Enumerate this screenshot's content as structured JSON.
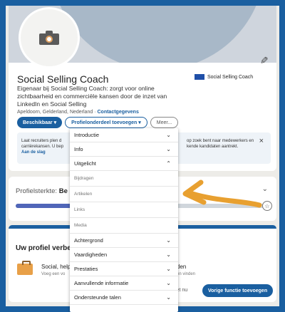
{
  "profile": {
    "name": "Social Selling Coach",
    "company": "Social Selling Coach",
    "headline": "Eigenaar bij Social Selling Coach: zorgt voor online zichtbaarheid en commerciële kansen door de inzet van LinkedIn en Social Selling",
    "location": "Apeldoorn, Gelderland, Nederland",
    "location_sep": " · ",
    "contact_link": "Contactgegevens",
    "buttons": {
      "available": "Beschikbaar ▾",
      "add_section": "Profielonderdeel toevoegen ▾",
      "more": "Meer..."
    }
  },
  "notice": {
    "left_text": "Laat recruiters plen d carrièrekansen. U bep",
    "left_link": "Aan de slag",
    "right_text": "op zoek bent naar medewerkers en kende kandidaten aantrekt.",
    "close": "×"
  },
  "strength": {
    "label": "Profielsterkte: ",
    "value": "Be",
    "progress": 0.62,
    "star": "☆"
  },
  "suggest": {
    "title": "Uw profiel verbe",
    "item": "Social, help",
    "item_sub": "Voeg een vo",
    "right_title": "den",
    "right_sub": "en vinden",
    "not_now": "iet nu",
    "button": "Vorige functie toevoegen"
  },
  "dropdown": {
    "rows": [
      {
        "type": "row",
        "label": "Introductie",
        "chev": "⌄"
      },
      {
        "type": "row",
        "label": "Info",
        "chev": "⌄"
      },
      {
        "type": "row",
        "label": "Uitgelicht",
        "chev": "⌃"
      },
      {
        "type": "sub",
        "label": "Bijdragen"
      },
      {
        "type": "sub",
        "label": "Artikelen"
      },
      {
        "type": "sub",
        "label": "Links"
      },
      {
        "type": "sub",
        "label": "Media"
      },
      {
        "type": "row",
        "label": "Achtergrond",
        "chev": "⌄"
      },
      {
        "type": "row",
        "label": "Vaardigheden",
        "chev": "⌄"
      },
      {
        "type": "row",
        "label": "Prestaties",
        "chev": "⌄"
      },
      {
        "type": "row",
        "label": "Aanvullende informatie",
        "chev": "⌄"
      },
      {
        "type": "row",
        "label": "Ondersteunde talen",
        "chev": "⌄"
      }
    ]
  },
  "colors": {
    "brand": "#1a5fa0",
    "arrow": "#e8a030"
  }
}
